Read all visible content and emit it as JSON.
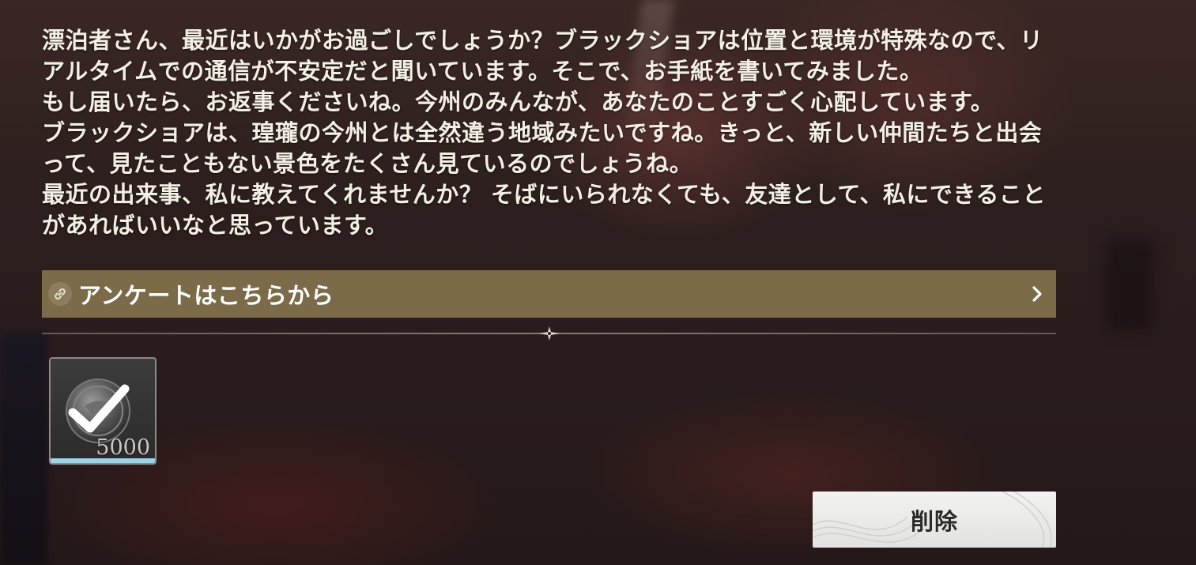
{
  "letter": {
    "paragraphs": [
      "漂泊者さん、最近はいかがお過ごしでしょうか？ブラックショアは位置と環境が特殊なので、リアルタイムでの通信が不安定だと聞いています。そこで、お手紙を書いてみました。",
      "もし届いたら、お返事くださいね。今州のみんなが、あなたのことすごく心配しています。",
      "ブラックショアは、瑝瓏の今州とは全然違う地域みたいですね。きっと、新しい仲間たちと出会って、見たこともない景色をたくさん見ているのでしょうね。",
      "最近の出来事、私に教えてくれませんか？ そばにいられなくても、友達として、私にできることがあればいいなと思っています。"
    ]
  },
  "survey_link": {
    "label": "アンケートはこちらから",
    "icon": "link-icon",
    "chevron": "chevron-right-icon"
  },
  "reward": {
    "icon": "checkmark-badge-icon",
    "quantity": "5000"
  },
  "actions": {
    "delete_label": "削除"
  },
  "colors": {
    "survey_bar": "#7b6b48",
    "letter_text": "#f3efe4",
    "reward_bar": "#9fd3e8",
    "delete_button": "#eeeeec"
  }
}
